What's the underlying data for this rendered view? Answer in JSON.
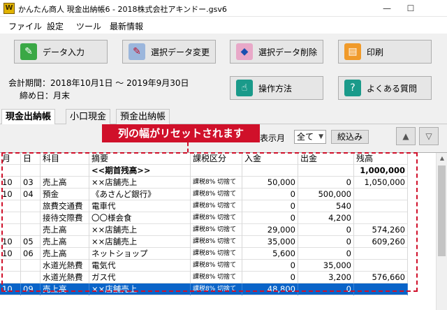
{
  "window": {
    "title": "かんたん商人 現金出納帳6 - 2018株式会社アキンドー.gsv6",
    "app_icon": "W",
    "min_glyph": "—",
    "max_glyph": "☐"
  },
  "menu": [
    "ファイル",
    "設定",
    "ツール",
    "最新情報"
  ],
  "toolbar": [
    {
      "label": "データ入力",
      "icon": "pencil-icon",
      "color": "#3aa845"
    },
    {
      "label": "選択データ変更",
      "icon": "edit-pencil-icon",
      "color": "#c0102a"
    },
    {
      "label": "選択データ削除",
      "icon": "eraser-icon",
      "color": "#e8a8c8"
    },
    {
      "label": "印刷",
      "icon": "print-icon",
      "color": "#f09a2a"
    },
    {
      "label": "操作方法",
      "icon": "hand-pointer-icon",
      "color": "#1a9a8a"
    },
    {
      "label": "よくある質問",
      "icon": "question-icon",
      "color": "#1a9a8a"
    }
  ],
  "period": {
    "text": "会計期間：2018年10月1日 ～ 2019年9月30日",
    "closing": "締め日：月末"
  },
  "tabs": [
    "現金出納帳",
    "小口現金",
    "預金出納帳"
  ],
  "filter": {
    "label": "表示月",
    "value": "全て",
    "button": "絞込み",
    "up": "▲",
    "down": "▽"
  },
  "callout": "列の幅がリセットされます",
  "grid": {
    "columns": [
      "月",
      "日",
      "科目",
      "摘要",
      "課税区分",
      "入金",
      "出金",
      "残高"
    ],
    "rows": [
      [
        "",
        "",
        "",
        "<<期首残高>>",
        "",
        "",
        "",
        "1,000,000"
      ],
      [
        "10",
        "03",
        "売上高",
        "××店舗売上",
        "課税8% 切捨て",
        "50,000",
        "0",
        "1,050,000"
      ],
      [
        "10",
        "04",
        "預金",
        "《あさんど銀行》",
        "課税8% 切捨て",
        "0",
        "500,000",
        ""
      ],
      [
        "",
        "",
        "旅費交通費",
        "電車代",
        "課税8% 切捨て",
        "0",
        "540",
        ""
      ],
      [
        "",
        "",
        "接待交際費",
        "〇〇様会食",
        "課税8% 切捨て",
        "0",
        "4,200",
        ""
      ],
      [
        "",
        "",
        "売上高",
        "××店舗売上",
        "課税8% 切捨て",
        "29,000",
        "0",
        "574,260"
      ],
      [
        "10",
        "05",
        "売上高",
        "××店舗売上",
        "課税8% 切捨て",
        "35,000",
        "0",
        "609,260"
      ],
      [
        "10",
        "06",
        "売上高",
        "ネットショップ",
        "課税8% 切捨て",
        "5,600",
        "0",
        ""
      ],
      [
        "",
        "",
        "水道光熱費",
        "電気代",
        "課税8% 切捨て",
        "0",
        "35,000",
        ""
      ],
      [
        "",
        "",
        "水道光熱費",
        "ガス代",
        "課税8% 切捨て",
        "0",
        "3,200",
        "576,660"
      ],
      [
        "10",
        "09",
        "売上高",
        "××店舗売上",
        "課税8% 切捨て",
        "48,800",
        "0",
        ""
      ]
    ]
  },
  "colors": {
    "accent": "#d0102a",
    "selection": "#0a64c8"
  }
}
